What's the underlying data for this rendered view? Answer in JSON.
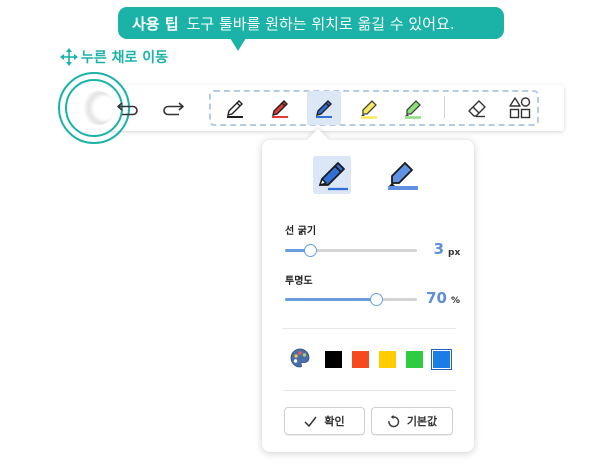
{
  "tooltip": {
    "title": "사용 팁",
    "text": "도구 툴바를 원하는 위치로 옮길 수 있어요."
  },
  "move_hint": {
    "label": "누른 채로 이동",
    "icon": "move-arrows-icon"
  },
  "toolbar": {
    "buttons": [
      {
        "name": "undo",
        "icon": "undo-icon"
      },
      {
        "name": "redo",
        "icon": "redo-icon"
      },
      {
        "name": "pen-black",
        "icon": "pen-icon",
        "color": "#222222"
      },
      {
        "name": "pen-red",
        "icon": "pen-icon",
        "color": "#e53935"
      },
      {
        "name": "pen-blue",
        "icon": "pen-icon",
        "color": "#2f6fd6",
        "selected": true
      },
      {
        "name": "highlighter-yellow",
        "icon": "highlighter-icon",
        "color": "#f7e95a"
      },
      {
        "name": "highlighter-green",
        "icon": "highlighter-icon",
        "color": "#8be07c"
      },
      {
        "name": "eraser",
        "icon": "eraser-icon"
      },
      {
        "name": "shapes",
        "icon": "shapes-icon"
      }
    ]
  },
  "popup": {
    "pen_types": [
      {
        "name": "pen",
        "icon": "pen-icon",
        "active": true
      },
      {
        "name": "highlighter",
        "icon": "highlighter-icon",
        "active": false
      }
    ],
    "thickness": {
      "label": "선 굵기",
      "value": "3",
      "unit": "px",
      "level": 0.2
    },
    "opacity": {
      "label": "투명도",
      "value": "70",
      "unit": "%",
      "level": 0.7
    },
    "palette_icon": "palette-icon",
    "colors": [
      "#000000",
      "#f44a1e",
      "#ffcc00",
      "#2ecc40",
      "#1a7de6"
    ],
    "selected_color_index": 4,
    "confirm_label": "확인",
    "reset_label": "기본값"
  },
  "colors": {
    "accent": "#1bb3a7",
    "selection": "#dce7f6",
    "value_text": "#5e8fd8"
  }
}
